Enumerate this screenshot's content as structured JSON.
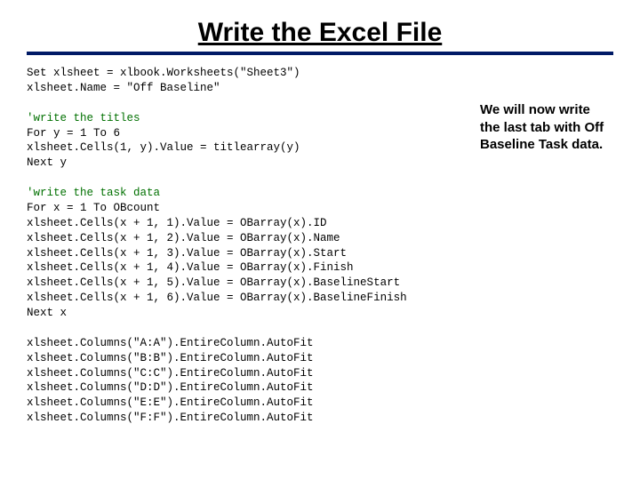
{
  "title": "Write the Excel File",
  "code": {
    "l1": "Set xlsheet = xlbook.Worksheets(\"Sheet3\")",
    "l2": "xlsheet.Name = \"Off Baseline\"",
    "c1": "'write the titles",
    "l3": "For y = 1 To 6",
    "l4": "xlsheet.Cells(1, y).Value = titlearray(y)",
    "l5": "Next y",
    "c2": "'write the task data",
    "l6": "For x = 1 To OBcount",
    "l7": "xlsheet.Cells(x + 1, 1).Value = OBarray(x).ID",
    "l8": "xlsheet.Cells(x + 1, 2).Value = OBarray(x).Name",
    "l9": "xlsheet.Cells(x + 1, 3).Value = OBarray(x).Start",
    "l10": "xlsheet.Cells(x + 1, 4).Value = OBarray(x).Finish",
    "l11": "xlsheet.Cells(x + 1, 5).Value = OBarray(x).BaselineStart",
    "l12": "xlsheet.Cells(x + 1, 6).Value = OBarray(x).BaselineFinish",
    "l13": "Next x",
    "l14": "xlsheet.Columns(\"A:A\").EntireColumn.AutoFit",
    "l15": "xlsheet.Columns(\"B:B\").EntireColumn.AutoFit",
    "l16": "xlsheet.Columns(\"C:C\").EntireColumn.AutoFit",
    "l17": "xlsheet.Columns(\"D:D\").EntireColumn.AutoFit",
    "l18": "xlsheet.Columns(\"E:E\").EntireColumn.AutoFit",
    "l19": "xlsheet.Columns(\"F:F\").EntireColumn.AutoFit"
  },
  "side": "We will now write the last tab with Off Baseline Task data."
}
